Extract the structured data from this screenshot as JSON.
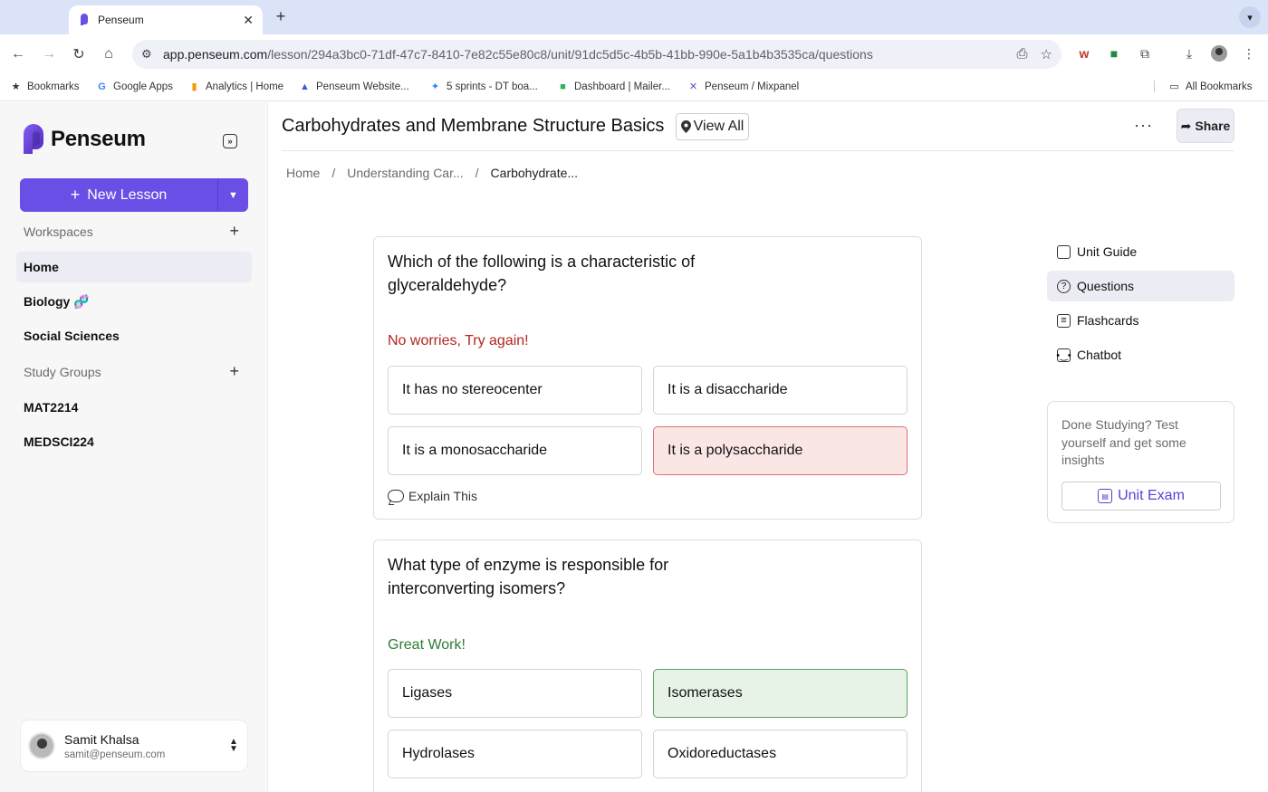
{
  "browser": {
    "tab_title": "Penseum",
    "tab_close": "✕",
    "new_tab": "+",
    "url_host": "app.penseum.com",
    "url_path": "/lesson/294a3bc0-71df-47c7-8410-7e82c55e80c8/unit/91dc5d5c-4b5b-41bb-990e-5a1b4b3535ca/questions",
    "bookmarks": [
      {
        "label": "Bookmarks",
        "icon": "star-icon"
      },
      {
        "label": "Google Apps",
        "icon": "google-icon"
      },
      {
        "label": "Analytics | Home",
        "icon": "analytics-icon"
      },
      {
        "label": "Penseum Website...",
        "icon": "triangle-icon"
      },
      {
        "label": "5 sprints - DT boa...",
        "icon": "jira-icon"
      },
      {
        "label": "Dashboard | Mailer...",
        "icon": "mailer-icon"
      },
      {
        "label": "Penseum / Mixpanel",
        "icon": "mixpanel-icon"
      }
    ],
    "all_bookmarks": "All Bookmarks"
  },
  "sidebar": {
    "logo_text": "Penseum",
    "new_lesson_label": "New Lesson",
    "workspaces_label": "Workspaces",
    "workspace_items": [
      {
        "label": "Home",
        "active": true
      },
      {
        "label": "Biology 🧬",
        "active": false
      },
      {
        "label": "Social Sciences",
        "active": false
      }
    ],
    "study_groups_label": "Study Groups",
    "study_group_items": [
      {
        "label": "MAT2214"
      },
      {
        "label": "MEDSCI224"
      }
    ],
    "user": {
      "name": "Samit Khalsa",
      "email": "samit@penseum.com"
    }
  },
  "header": {
    "title": "Carbohydrates and Membrane Structure Basics",
    "view_all_label": "View All",
    "more_label": "···",
    "share_label": "Share"
  },
  "breadcrumb": {
    "items": [
      "Home",
      "Understanding Car...",
      "Carbohydrate..."
    ],
    "separator": "/"
  },
  "questions": [
    {
      "text": "Which of the following is a characteristic of glyceraldehyde?",
      "feedback": "No worries, Try again!",
      "feedback_type": "wrong",
      "options": [
        {
          "label": "It has no stereocenter",
          "state": "neutral"
        },
        {
          "label": "It is a disaccharide",
          "state": "neutral"
        },
        {
          "label": "It is a monosaccharide",
          "state": "neutral"
        },
        {
          "label": "It is a polysaccharide",
          "state": "wrong"
        }
      ],
      "explain_label": "Explain This"
    },
    {
      "text": "What type of enzyme is responsible for interconverting isomers?",
      "feedback": "Great Work!",
      "feedback_type": "right",
      "options": [
        {
          "label": "Ligases",
          "state": "neutral"
        },
        {
          "label": "Isomerases",
          "state": "right"
        },
        {
          "label": "Hydrolases",
          "state": "neutral"
        },
        {
          "label": "Oxidoreductases",
          "state": "neutral"
        }
      ]
    }
  ],
  "right_panel": {
    "nav": [
      {
        "label": "Unit Guide",
        "icon": "book-icon",
        "active": false
      },
      {
        "label": "Questions",
        "icon": "question-icon",
        "active": true
      },
      {
        "label": "Flashcards",
        "icon": "flashcards-icon",
        "active": false
      },
      {
        "label": "Chatbot",
        "icon": "robot-icon",
        "active": false
      }
    ],
    "exam_prompt": "Done Studying? Test yourself and get some insights",
    "exam_button": "Unit Exam"
  },
  "colors": {
    "accent": "#6b4ee6",
    "wrong": "#b3261e",
    "right": "#2e7d32"
  }
}
